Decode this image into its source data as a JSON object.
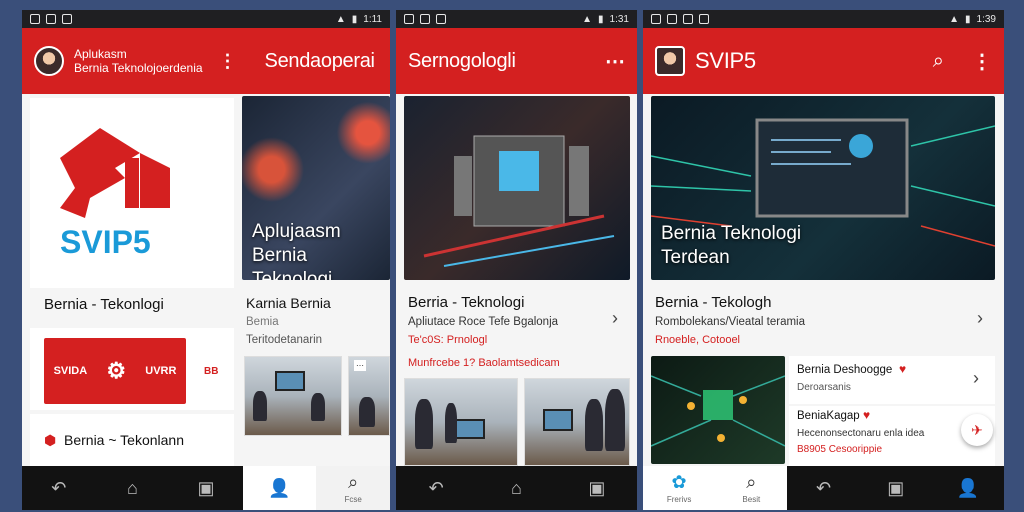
{
  "colors": {
    "brand_red": "#d42020",
    "dark": "#121212"
  },
  "screen1": {
    "status_time": "1:11",
    "app_title_line1": "Aplukasm",
    "app_title_line2": "Bernia Teknolojoerdenia",
    "tab_title": "Sendaoperai",
    "logo_text": "SVIP5",
    "logo_mark": "ᗡƔ IPS",
    "card_heading": "Bernia - Tekonlogi",
    "banner_text": "SVIDA",
    "banner_text_right": "UVRR",
    "banner_side": "BB",
    "footer_item": "Bernia ~ Tekonlann",
    "feature_overlay": "Aplujaasm Bernia Teknologi",
    "feature_heading": "Karnia Bernia",
    "feature_sub1": "Bemia",
    "feature_sub2": "Teritodetanarin",
    "side_label": "Fcse",
    "nav_search_label": "Fcse"
  },
  "screen2": {
    "status_time": "1:31",
    "title": "Sernogologli",
    "card_heading": "Berria - Teknologi",
    "card_sub": "Apliutace Roce Tefe Bgalonja",
    "card_red": "Te'c0S: Prnologl",
    "card_red2": "Munfrcebe 1? Baolamtsedicam"
  },
  "screen3": {
    "status_time": "1:39",
    "title": "SVIP5",
    "feature_overlay_line1": "Bernia Teknologi",
    "feature_overlay_line2": "Terdean",
    "card_heading": "Bernia - Tekologh",
    "card_sub": "Rombolekans/Vieatal teramia",
    "card_red": "Rnoeble, Cotooel",
    "item1_title": "Bernia Deshoogge",
    "item1_sub": "Deroarsanis",
    "item2_title": "BeniaKagap",
    "item2_sub": "Hecenonsectonaru enla idea",
    "item2_red": "B8905 Cesoorippie",
    "nav_label1": "Frerivs",
    "nav_label2": "Besit"
  }
}
